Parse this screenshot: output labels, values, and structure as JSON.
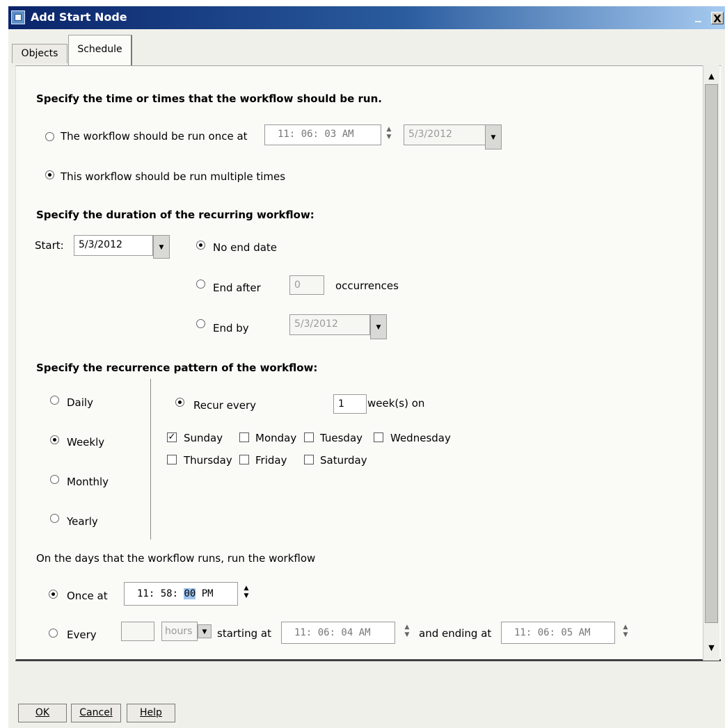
{
  "window": {
    "title": "Add Start Node",
    "close_glyph": "X",
    "minimize_glyph": "_"
  },
  "tabs": [
    {
      "label": "Objects",
      "active": false
    },
    {
      "label": "Schedule",
      "active": true
    }
  ],
  "section1": {
    "heading": "Specify the time or times that the workflow should be run.",
    "run_once_label": "The workflow should be run once at",
    "run_once_time": "11: 06: 03 AM",
    "run_once_date": "5/3/2012",
    "run_multiple_label": "This workflow should be run multiple times",
    "selected": "multiple"
  },
  "section2": {
    "heading": "Specify the duration of the recurring workflow:",
    "start_label": "Start:",
    "start_date": "5/3/2012",
    "no_end_label": "No end date",
    "end_after_label": "End after",
    "end_after_value": "0",
    "occurrences_label": "occurrences",
    "end_by_label": "End by",
    "end_by_date": "5/3/2012",
    "selected": "no_end"
  },
  "section3": {
    "heading": "Specify the recurrence pattern of the workflow:",
    "patterns": [
      "Daily",
      "Weekly",
      "Monthly",
      "Yearly"
    ],
    "selected_pattern": "Weekly",
    "recur_every_label": "Recur every",
    "recur_every_value": "1",
    "weeks_on_label": "week(s) on",
    "days": [
      {
        "label": "Sunday",
        "checked": true
      },
      {
        "label": "Monday",
        "checked": false
      },
      {
        "label": "Tuesday",
        "checked": false
      },
      {
        "label": "Wednesday",
        "checked": false
      },
      {
        "label": "Thursday",
        "checked": false
      },
      {
        "label": "Friday",
        "checked": false
      },
      {
        "label": "Saturday",
        "checked": false
      }
    ]
  },
  "section4": {
    "heading": "On the days that the workflow runs, run the workflow",
    "once_at_label": "Once at",
    "once_at_time_hm": "11: 58: ",
    "once_at_time_sec": "00",
    "once_at_time_ampm": " PM",
    "every_label": "Every",
    "every_value": "",
    "unit": "hours",
    "starting_at_label": "starting at",
    "starting_at_time": "11: 06: 04 AM",
    "ending_at_label": "and ending at",
    "ending_at_time": "11: 06: 05 AM",
    "selected": "once"
  },
  "buttons": {
    "ok": "OK",
    "cancel": "Cancel",
    "help": "Help"
  },
  "icons": {
    "app": "app-icon",
    "spinner": "spinner-up-down-icon",
    "dropdown": "dropdown-arrow-icon",
    "scroll_up": "scroll-up-arrow-icon",
    "scroll_down": "scroll-down-arrow-icon"
  },
  "colors": {
    "titlebar_start": "#0a246a",
    "titlebar_end": "#a6caf0",
    "selection": "#9dc3ee"
  }
}
